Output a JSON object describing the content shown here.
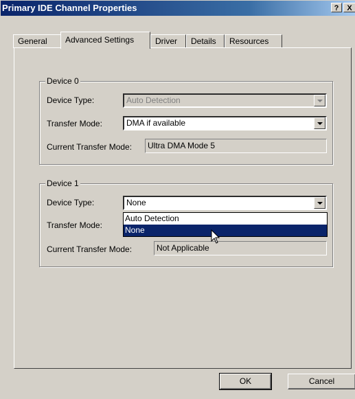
{
  "window": {
    "title": "Primary IDE Channel Properties",
    "help_button": "?",
    "close_button": "X"
  },
  "tabs": [
    {
      "label": "General",
      "active": false
    },
    {
      "label": "Advanced Settings",
      "active": true
    },
    {
      "label": "Driver",
      "active": false
    },
    {
      "label": "Details",
      "active": false
    },
    {
      "label": "Resources",
      "active": false
    }
  ],
  "device0": {
    "group_label": "Device 0",
    "device_type_label": "Device Type:",
    "device_type_value": "Auto Detection",
    "transfer_mode_label": "Transfer Mode:",
    "transfer_mode_value": "DMA if available",
    "current_transfer_mode_label": "Current Transfer Mode:",
    "current_transfer_mode_value": "Ultra DMA Mode 5"
  },
  "device1": {
    "group_label": "Device 1",
    "device_type_label": "Device Type:",
    "device_type_value": "None",
    "transfer_mode_label": "Transfer Mode:",
    "current_transfer_mode_label": "Current Transfer Mode:",
    "current_transfer_mode_value": "Not Applicable",
    "dropdown_options": [
      "Auto Detection",
      "None"
    ],
    "dropdown_selected": "None"
  },
  "buttons": {
    "ok": "OK",
    "cancel": "Cancel"
  }
}
